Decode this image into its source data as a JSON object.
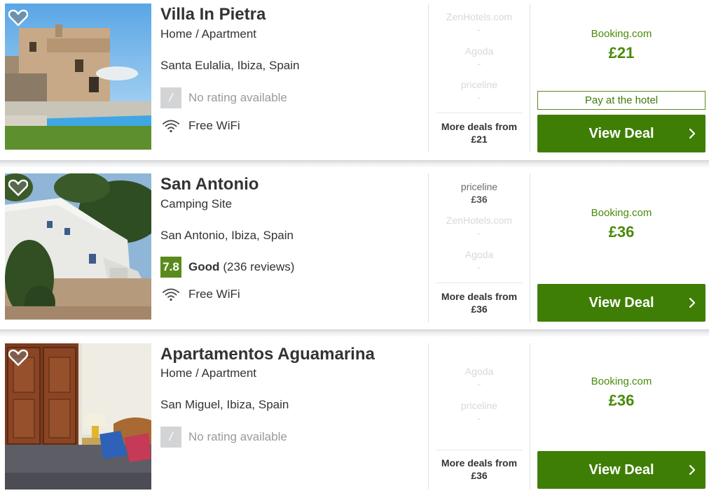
{
  "listings": [
    {
      "name": "Villa In Pietra",
      "property_type": "Home / Apartment",
      "location": "Santa Eulalia, Ibiza, Spain",
      "rating": {
        "score": "/",
        "text": "No rating available"
      },
      "amenity": "Free WiFi",
      "deals": [
        {
          "site": "ZenHotels.com",
          "price": "-"
        },
        {
          "site": "Agoda",
          "price": "-"
        },
        {
          "site": "priceline",
          "price": "-"
        }
      ],
      "more_deals_label": "More deals from",
      "more_deals_price": "£21",
      "main_site": "Booking.com",
      "main_price": "£21",
      "pay_at_hotel": "Pay at the hotel",
      "button_label": "View Deal"
    },
    {
      "name": "San Antonio",
      "property_type": "Camping Site",
      "location": "San Antonio, Ibiza, Spain",
      "rating": {
        "score": "7.8",
        "word": "Good",
        "reviews": "(236 reviews)"
      },
      "amenity": "Free WiFi",
      "deals": [
        {
          "site": "priceline",
          "price": "£36"
        },
        {
          "site": "ZenHotels.com",
          "price": "-"
        },
        {
          "site": "Agoda",
          "price": "-"
        }
      ],
      "more_deals_label": "More deals from",
      "more_deals_price": "£36",
      "main_site": "Booking.com",
      "main_price": "£36",
      "button_label": "View Deal"
    },
    {
      "name": "Apartamentos Aguamarina",
      "property_type": "Home / Apartment",
      "location": "San Miguel, Ibiza, Spain",
      "rating": {
        "score": "/",
        "text": "No rating available"
      },
      "deals": [
        {
          "site": "Agoda",
          "price": "-"
        },
        {
          "site": "priceline",
          "price": "-"
        }
      ],
      "more_deals_label": "More deals from",
      "more_deals_price": "£36",
      "main_site": "Booking.com",
      "main_price": "£36",
      "button_label": "View Deal"
    }
  ],
  "icons": {
    "favorite": "heart-icon",
    "wifi": "wifi-icon",
    "chevron": "chevron-right-icon"
  },
  "colors": {
    "brand_green": "#3f7e05",
    "price_green": "#4a8a0a",
    "rating_good": "#5a8a1c",
    "rating_none": "#d3d4d5"
  }
}
